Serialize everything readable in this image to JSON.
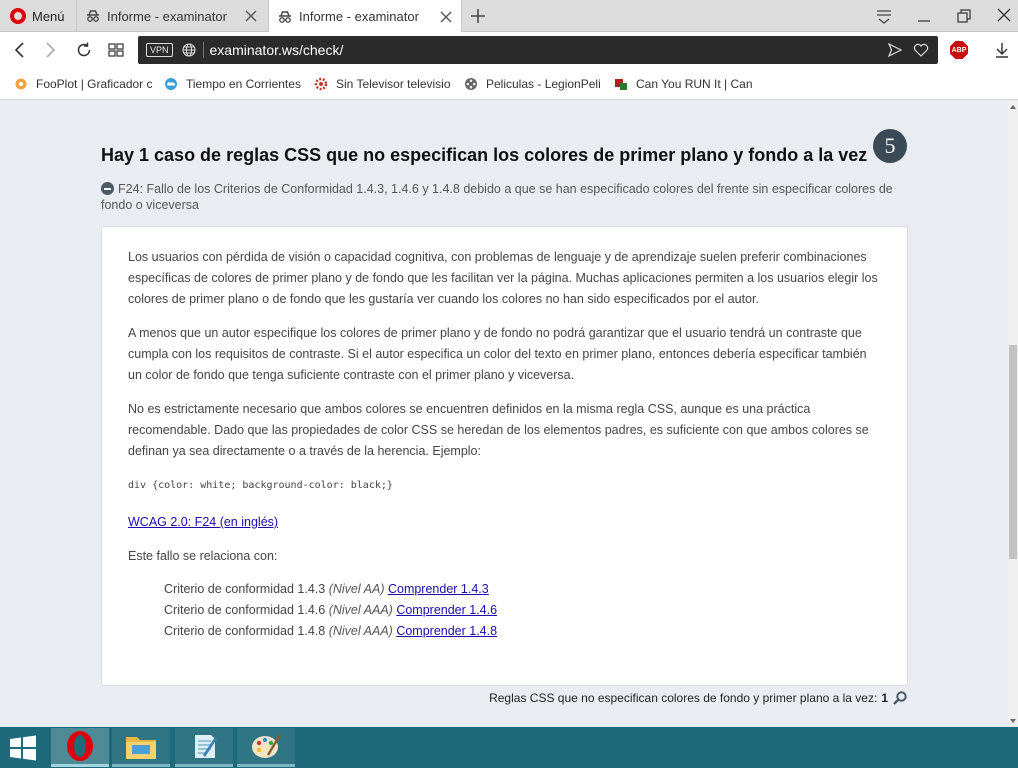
{
  "browser": {
    "menu_label": "Menú",
    "tabs": [
      {
        "label": "Informe - examinator",
        "active": false
      },
      {
        "label": "Informe - examinator",
        "active": true
      }
    ],
    "vpn_label": "VPN",
    "url": "examinator.ws/check/",
    "abp_label": "ABP"
  },
  "bookmarks": [
    {
      "label": "FooPlot | Graficador c",
      "icon": "fooplot-icon"
    },
    {
      "label": "Tiempo en Corrientes",
      "icon": "weather-icon"
    },
    {
      "label": "Sin Televisor televisio",
      "icon": "gear-site-icon"
    },
    {
      "label": "Peliculas - LegionPeli",
      "icon": "film-reel-icon"
    },
    {
      "label": "Can You RUN It | Can",
      "icon": "canyourunit-icon"
    }
  ],
  "page": {
    "title": "Hay 1 caso de reglas CSS que no especifican los colores de primer plano y fondo a la vez",
    "count": "5",
    "failure": "F24: Fallo de los Criterios de Conformidad 1.4.3, 1.4.6 y 1.4.8 debido a que se han especificado colores del frente sin especificar colores de fondo o viceversa",
    "paragraphs": [
      "Los usuarios con pérdida de visión o capacidad cognitiva, con problemas de lenguaje y de aprendizaje suelen preferir combinaciones específicas de colores de primer plano y de fondo que les facilitan ver la página. Muchas aplicaciones permiten a los usuarios elegir los colores de primer plano o de fondo que les gustaría ver cuando los colores no han sido especificados por el autor.",
      "A menos que un autor especifique los colores de primer plano y de fondo no podrá garantizar que el usuario tendrá un contraste que cumpla con los requisitos de contraste. Si el autor especifica un color del texto en primer plano, entonces debería especificar también un color de fondo que tenga suficiente contraste con el primer plano y viceversa.",
      "No es estrictamente necesario que ambos colores se encuentren definidos en la misma regla CSS, aunque es una práctica recomendable. Dado que las propiedades de color CSS se heredan de los elementos padres, es suficiente con que ambos colores se definan ya sea directamente o a través de la herencia. Ejemplo:"
    ],
    "code_example": "div {color: white; background-color: black;}",
    "wcag_link": "WCAG 2.0: F24 (en inglés)",
    "related_intro": "Este fallo se relaciona con:",
    "criteria": [
      {
        "text": "Criterio de conformidad 1.4.3",
        "level": "(Nivel AA)",
        "link": "Comprender 1.4.3"
      },
      {
        "text": "Criterio de conformidad 1.4.6",
        "level": "(Nivel AAA)",
        "link": "Comprender 1.4.6"
      },
      {
        "text": "Criterio de conformidad 1.4.8",
        "level": "(Nivel AAA)",
        "link": "Comprender 1.4.8"
      }
    ],
    "footer_label": "Reglas CSS que no especifican colores de fondo y primer plano a la vez:",
    "footer_count": "1"
  },
  "colors": {
    "page_bg": "#e9edf2",
    "badge_bg": "#3a4a56",
    "link": "#1a0dab",
    "taskbar": "#1e6a7a",
    "opera_red": "#e0000c"
  }
}
